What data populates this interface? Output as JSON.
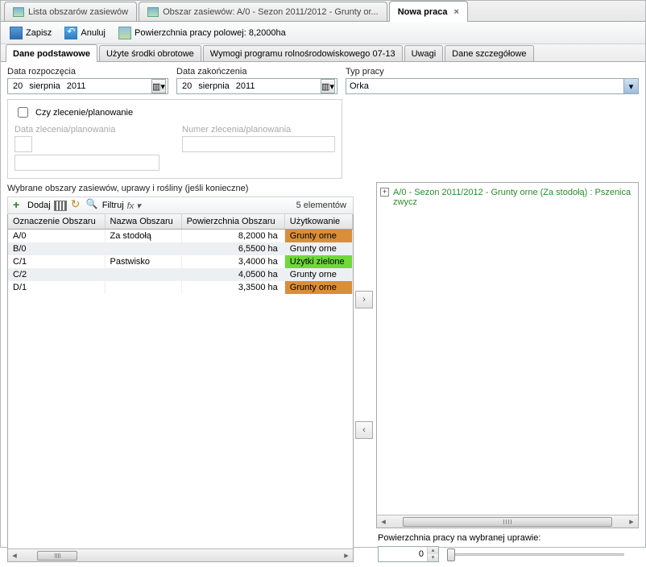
{
  "tabs": [
    {
      "label": "Lista obszarów zasiewów"
    },
    {
      "label": "Obszar zasiewów: A/0 - Sezon 2011/2012 - Grunty or..."
    },
    {
      "label": "Nowa praca",
      "active": true
    }
  ],
  "toolbar": {
    "save": "Zapisz",
    "cancel": "Anuluj",
    "surface": "Powierzchnia pracy polowej: 8,2000ha"
  },
  "subtabs": [
    {
      "label": "Dane podstawowe",
      "active": true
    },
    {
      "label": "Użyte środki obrotowe"
    },
    {
      "label": "Wymogi programu rolnośrodowiskowego 07-13"
    },
    {
      "label": "Uwagi"
    },
    {
      "label": "Dane szczegółowe"
    }
  ],
  "dates": {
    "start_label": "Data rozpoczęcia",
    "end_label": "Data zakończenia",
    "day": "20",
    "month": "sierpnia",
    "year": "2011"
  },
  "type": {
    "label": "Typ pracy",
    "value": "Orka"
  },
  "plan": {
    "chk": "Czy zlecenie/planowanie",
    "date_label": "Data zlecenia/planowania",
    "num_label": "Numer zlecenia/planowania"
  },
  "list": {
    "title": "Wybrane obszary zasiewów, uprawy i rośliny (jeśli konieczne)",
    "add": "Dodaj",
    "filter": "Filtruj",
    "fx": "fx ▾",
    "count": "5 elementów",
    "cols": {
      "c1": "Oznaczenie Obszaru",
      "c2": "Nazwa Obszaru",
      "c3": "Powierzchnia Obszaru",
      "c4": "Użytkowanie"
    },
    "rows": [
      {
        "oz": "A/0",
        "nz": "Za stodołą",
        "pw": "8,2000 ha",
        "uk": "Grunty orne",
        "cls": "orn"
      },
      {
        "oz": "B/0",
        "nz": "",
        "pw": "6,5500 ha",
        "uk": "Grunty orne",
        "cls": "orn"
      },
      {
        "oz": "C/1",
        "nz": "Pastwisko",
        "pw": "3,4000 ha",
        "uk": "Użytki zielone",
        "cls": "grn"
      },
      {
        "oz": "C/2",
        "nz": "",
        "pw": "4,0500 ha",
        "uk": "Grunty orne",
        "cls": "orn"
      },
      {
        "oz": "D/1",
        "nz": "",
        "pw": "3,3500 ha",
        "uk": "Grunty orne",
        "cls": "orn"
      }
    ]
  },
  "tree": {
    "item": "A/0 - Sezon 2011/2012 - Grunty orne (Za stodołą) : Pszenica zwycz"
  },
  "footer": {
    "label": "Powierzchnia pracy na wybranej uprawie:",
    "value": "0"
  }
}
